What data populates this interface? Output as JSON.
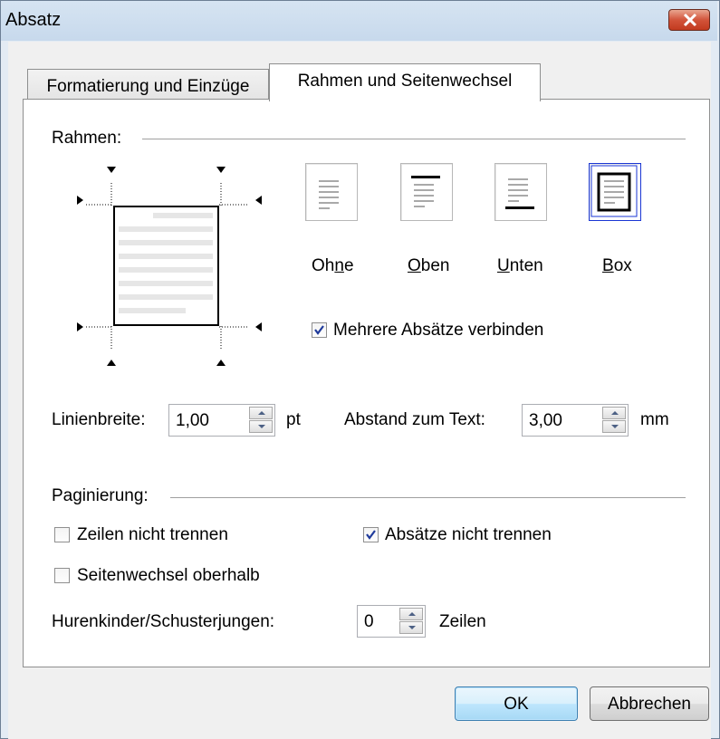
{
  "window": {
    "title": "Absatz",
    "close_icon": "close-icon"
  },
  "tabs": [
    {
      "label": "Formatierung und Einzüge",
      "active": false
    },
    {
      "label": "Rahmen und Seitenwechsel",
      "active": true
    }
  ],
  "rahmen": {
    "group_label": "Rahmen:",
    "styles": [
      {
        "label": "Ohne",
        "mnemonic_prefix": "Oh",
        "mnemonic": "n",
        "mnemonic_suffix": "e",
        "selected": false
      },
      {
        "label": "Oben",
        "mnemonic_prefix": "",
        "mnemonic": "O",
        "mnemonic_suffix": "ben",
        "selected": false
      },
      {
        "label": "Unten",
        "mnemonic_prefix": "",
        "mnemonic": "U",
        "mnemonic_suffix": "nten",
        "selected": false
      },
      {
        "label": "Box",
        "mnemonic_prefix": "",
        "mnemonic": "B",
        "mnemonic_suffix": "ox",
        "selected": true
      }
    ],
    "merge_checkbox": {
      "label": "Mehrere Absätze verbinden",
      "checked": true
    },
    "line_width": {
      "label": "Linienbreite:",
      "value": "1,00",
      "unit": "pt"
    },
    "text_distance": {
      "label": "Abstand zum Text:",
      "value": "3,00",
      "unit": "mm"
    }
  },
  "paginierung": {
    "group_label": "Paginierung:",
    "keep_lines": {
      "label": "Zeilen nicht trennen",
      "checked": false
    },
    "keep_paragraphs": {
      "label": "Absätze nicht trennen",
      "checked": true
    },
    "page_break_before": {
      "label": "Seitenwechsel oberhalb",
      "checked": false
    },
    "widows": {
      "label": "Hurenkinder/Schusterjungen:",
      "value": "0",
      "unit": "Zeilen"
    }
  },
  "buttons": {
    "ok": "OK",
    "cancel": "Abbrechen"
  },
  "colors": {
    "selection": "#1a36d4",
    "titlebar": "#d6e4f2",
    "close": "#c23a1f"
  }
}
